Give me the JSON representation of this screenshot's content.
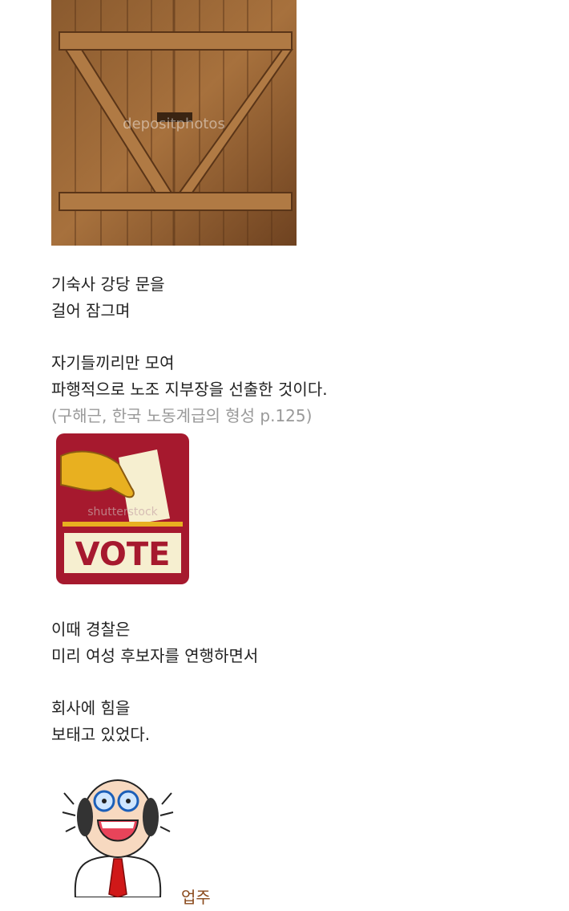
{
  "post": {
    "image1": {
      "alt": "wooden barn door",
      "watermark": "depositphotos"
    },
    "para1": [
      "기숙사 강당 문을",
      "걸어 잠그며"
    ],
    "para2": [
      "자기들끼리만 모여",
      "파행적으로 노조 지부장을 선출한 것이다."
    ],
    "citation": "(구해근, 한국 노동계급의 형성 p.125)",
    "image2": {
      "label": "VOTE",
      "watermark": "shutterstock"
    },
    "para3": [
      "이때 경찰은",
      "미리 여성 후보자를 연행하면서"
    ],
    "para4": [
      "회사에 힘을",
      "보태고 있었다."
    ],
    "image3": {
      "alt": "shouting bald man cartoon",
      "caption": "업주"
    }
  },
  "colors": {
    "text": "#222222",
    "citation": "#999999",
    "caption": "#8a4a1c",
    "vote_red": "#a6192e",
    "vote_cream": "#f6efd0"
  }
}
